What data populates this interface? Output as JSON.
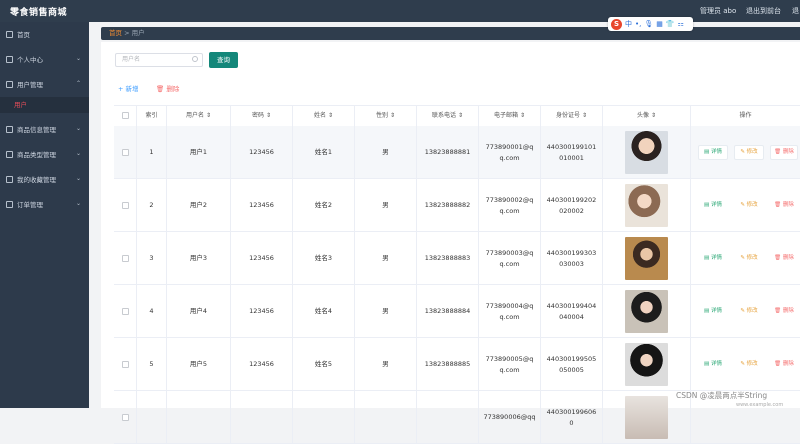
{
  "topbar": {
    "title": "零食销售商城",
    "admin_label": "管理员 abo",
    "backend_label": "退出到前台",
    "logout_label": "退"
  },
  "sidebar": {
    "items": [
      {
        "label": "首页",
        "icon": "home-icon"
      },
      {
        "label": "个人中心",
        "icon": "user-icon"
      },
      {
        "label": "用户管理",
        "icon": "users-icon",
        "expanded": true
      },
      {
        "label": "商品信息管理",
        "icon": "goods-icon"
      },
      {
        "label": "商品类型管理",
        "icon": "category-icon"
      },
      {
        "label": "我的收藏管理",
        "icon": "favorite-icon"
      },
      {
        "label": "订单管理",
        "icon": "order-icon"
      }
    ],
    "sub_item": "用户"
  },
  "breadcrumb": {
    "home": "首页",
    "separator": ">",
    "current": "用户"
  },
  "ime": {
    "logo": "S",
    "lang": "中"
  },
  "toolbar": {
    "search_placeholder": "用户名",
    "search_button": "查询",
    "add_button": "+ 新增",
    "delete_button": "删除"
  },
  "table": {
    "headers": [
      "",
      "索引",
      "用户名 ⇕",
      "密码 ⇕",
      "姓名 ⇕",
      "性别 ⇕",
      "联系电话 ⇕",
      "电子邮箱 ⇕",
      "身份证号 ⇕",
      "头像 ⇕",
      "操作"
    ],
    "rows": [
      {
        "index": "1",
        "username": "用户1",
        "password": "123456",
        "name": "姓名1",
        "gender": "男",
        "phone": "13823888881",
        "email": "773890001@qq.com",
        "idcard": "440300199101010001"
      },
      {
        "index": "2",
        "username": "用户2",
        "password": "123456",
        "name": "姓名2",
        "gender": "男",
        "phone": "13823888882",
        "email": "773890002@qq.com",
        "idcard": "440300199202020002"
      },
      {
        "index": "3",
        "username": "用户3",
        "password": "123456",
        "name": "姓名3",
        "gender": "男",
        "phone": "13823888883",
        "email": "773890003@qq.com",
        "idcard": "440300199303030003"
      },
      {
        "index": "4",
        "username": "用户4",
        "password": "123456",
        "name": "姓名4",
        "gender": "男",
        "phone": "13823888884",
        "email": "773890004@qq.com",
        "idcard": "440300199404040004"
      },
      {
        "index": "5",
        "username": "用户5",
        "password": "123456",
        "name": "姓名5",
        "gender": "男",
        "phone": "13823888885",
        "email": "773890005@qq.com",
        "idcard": "440300199505050005"
      },
      {
        "index": "",
        "username": "",
        "password": "",
        "name": "",
        "gender": "",
        "phone": "",
        "email": "773890006@qq",
        "idcard": "4403001996060"
      }
    ],
    "actions": {
      "view": "详情",
      "edit": "修改",
      "delete": "删除"
    }
  },
  "watermark": {
    "text": "CSDN @凌晨两点半String",
    "site": "www.example.com"
  },
  "colors": {
    "topbar": "#2f3d4d",
    "sidebar": "#2d3a4b",
    "accent": "#14877a",
    "danger": "#f56c6c",
    "warning": "#e6a23c",
    "success": "#2aa775"
  }
}
